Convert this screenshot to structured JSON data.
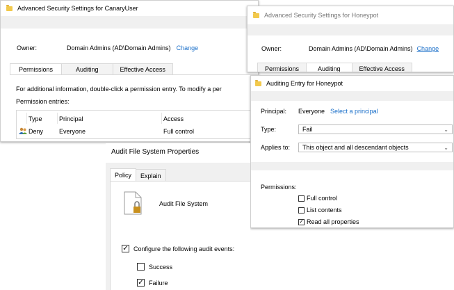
{
  "win1": {
    "title": "Advanced Security Settings for CanaryUser",
    "owner_label": "Owner:",
    "owner_value": "Domain Admins (AD\\Domain Admins)",
    "change": "Change",
    "tabs": [
      "Permissions",
      "Auditing",
      "Effective Access"
    ],
    "info": "For additional information, double-click a permission entry. To modify a per",
    "entries_label": "Permission entries:",
    "columns": [
      "Type",
      "Principal",
      "Access"
    ],
    "rows": [
      {
        "type": "Deny",
        "principal": "Everyone",
        "access": "Full control"
      }
    ]
  },
  "win2": {
    "title": "Advanced Security Settings for Honeypot",
    "owner_label": "Owner:",
    "owner_value": "Domain Admins (AD\\Domain Admins)",
    "change": "Change",
    "tabs": [
      "Permissions",
      "Auditing",
      "Effective Access"
    ]
  },
  "win3": {
    "title": "Auditing Entry for Honeypot",
    "principal_label": "Principal:",
    "principal_value": "Everyone",
    "select_principal": "Select a principal",
    "type_label": "Type:",
    "type_value": "Fail",
    "applies_label": "Applies to:",
    "applies_value": "This object and all descendant objects",
    "permissions_label": "Permissions:",
    "perms": [
      {
        "label": "Full control",
        "checked": false
      },
      {
        "label": "List contents",
        "checked": false
      },
      {
        "label": "Read all properties",
        "checked": true
      }
    ]
  },
  "win4": {
    "title": "Audit File System Properties",
    "tabs": [
      "Policy",
      "Explain"
    ],
    "policy_name": "Audit File System",
    "configure_label": "Configure the following audit events:",
    "configure_checked": true,
    "success_label": "Success",
    "success_checked": false,
    "failure_label": "Failure",
    "failure_checked": true
  }
}
